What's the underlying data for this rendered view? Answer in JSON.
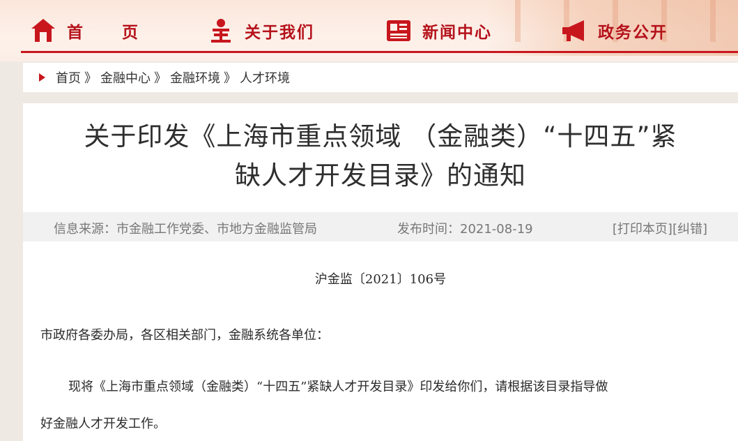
{
  "header": {
    "nav": [
      {
        "label": "首 页",
        "icon": "home-icon"
      },
      {
        "label": "关于我们",
        "icon": "people-icon"
      },
      {
        "label": "新闻中心",
        "icon": "newspaper-icon"
      },
      {
        "label": "政务公开",
        "icon": "megaphone-icon"
      }
    ],
    "accent_color": "#c8161d"
  },
  "breadcrumb": {
    "items": [
      "首页",
      "金融中心",
      "金融环境",
      "人才环境"
    ],
    "separator": "》"
  },
  "article": {
    "title_line1": "关于印发《上海市重点领域 （金融类）“十四五”紧",
    "title_line2": "缺人才开发目录》的通知",
    "source_label": "信息来源：",
    "source": "市金融工作党委、市地方金融监管局",
    "date_label": "发布时间：",
    "date": "2021-08-19",
    "print_label": "[打印本页]",
    "correct_label": "[纠错]",
    "doc_number": "沪金监〔2021〕106号",
    "greeting": "市政府各委办局，各区相关部门，金融系统各单位：",
    "paragraph_line1": "现将《上海市重点领域（金融类）“十四五”紧缺人才开发目录》印发给你们，请根据该目录指导做",
    "paragraph_line2": "好金融人才开发工作。"
  }
}
